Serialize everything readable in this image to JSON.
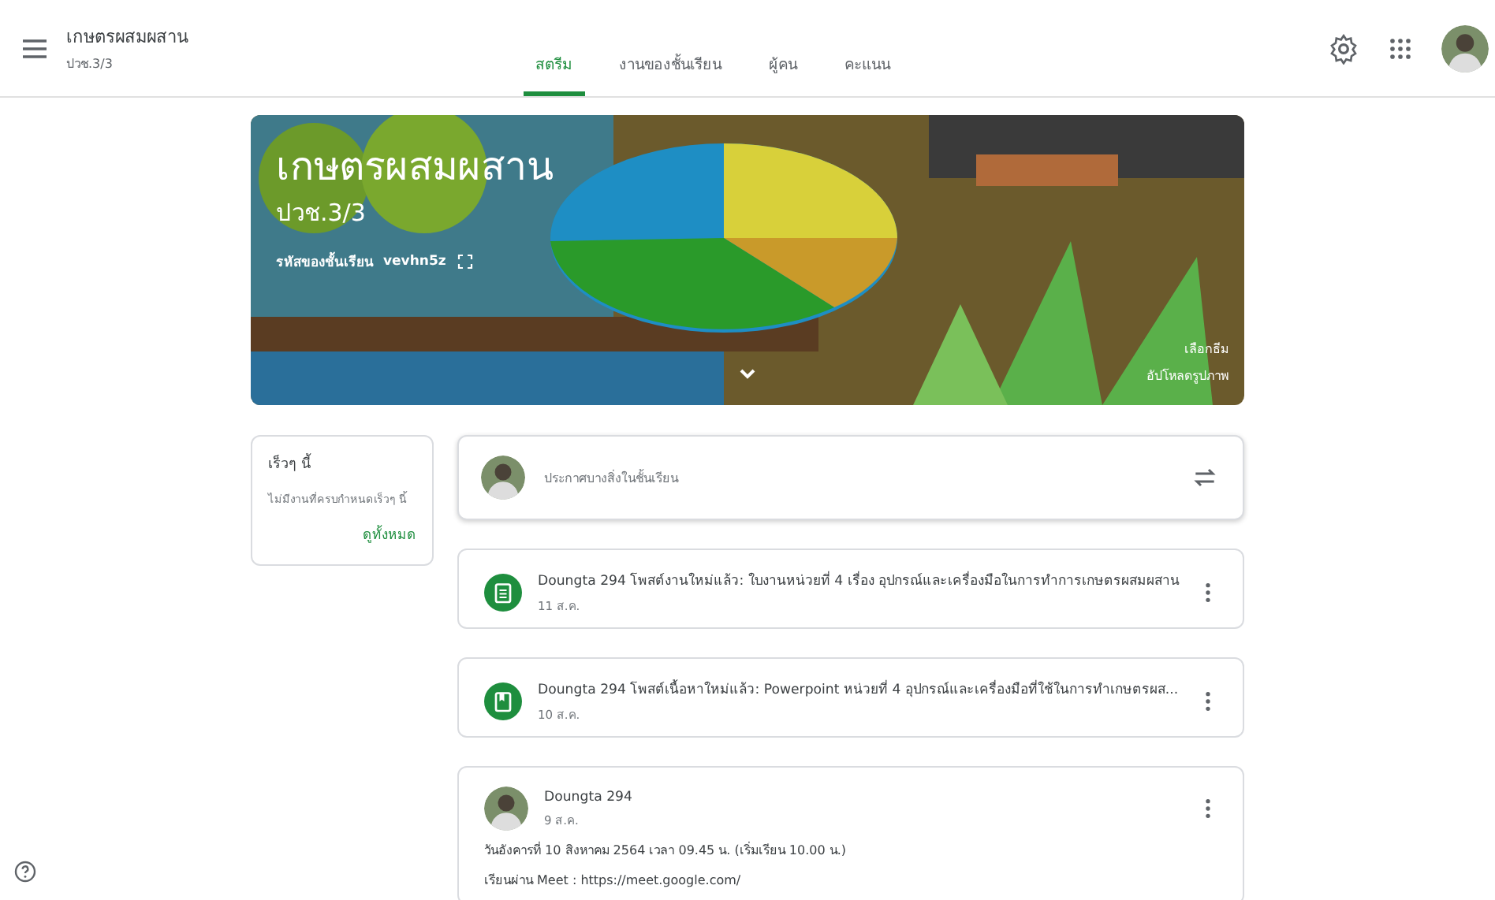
{
  "header": {
    "title": "เกษตรผสมผสาน",
    "subtitle": "ปวช.3/3"
  },
  "tabs": [
    {
      "label": "สตรีม",
      "selected": true
    },
    {
      "label": "งานของชั้นเรียน",
      "selected": false
    },
    {
      "label": "ผู้คน",
      "selected": false
    },
    {
      "label": "คะแนน",
      "selected": false
    }
  ],
  "banner": {
    "kind": "picture",
    "title": "เกษตรผสมผสาน",
    "section": "ปวช.3/3",
    "code_label": "รหัสของชั้นเรียน",
    "code": "vevhn5z",
    "theme_link": "เลือกธีม",
    "upload_link": "อัปโหลดรูปภาพ"
  },
  "upcoming": {
    "title": "เร็วๆ นี้",
    "empty": "ไม่มีงานที่ครบกำหนดเร็วๆ นี้",
    "view_all": "ดูทั้งหมด"
  },
  "composer": {
    "placeholder": "ประกาศบางสิ่งในชั้นเรียน"
  },
  "posts": [
    {
      "kind": "assignment",
      "text": "Doungta 294 โพสต์งานใหม่แล้ว: ใบงานหน่วยที่ 4 เรื่อง อุปกรณ์และเครื่องมือในการทำการเกษตรผสมผสาน",
      "date": "11 ส.ค."
    },
    {
      "kind": "material",
      "text": "Doungta 294 โพสต์เนื้อหาใหม่แล้ว: Powerpoint หน่วยที่ 4 อุปกรณ์และเครื่องมือที่ใช้ในการทำเกษตรผส...",
      "date": "10 ส.ค."
    },
    {
      "kind": "announcement",
      "text": "Doungta 294",
      "date": "9 ส.ค.",
      "body": [
        "วันอังคารที่ 10 สิงหาคม 2564 เวลา 09.45 น. (เริ่มเรียน 10.00 น.)",
        "เรียนผ่าน Meet : https://meet.google.com/"
      ]
    }
  ]
}
